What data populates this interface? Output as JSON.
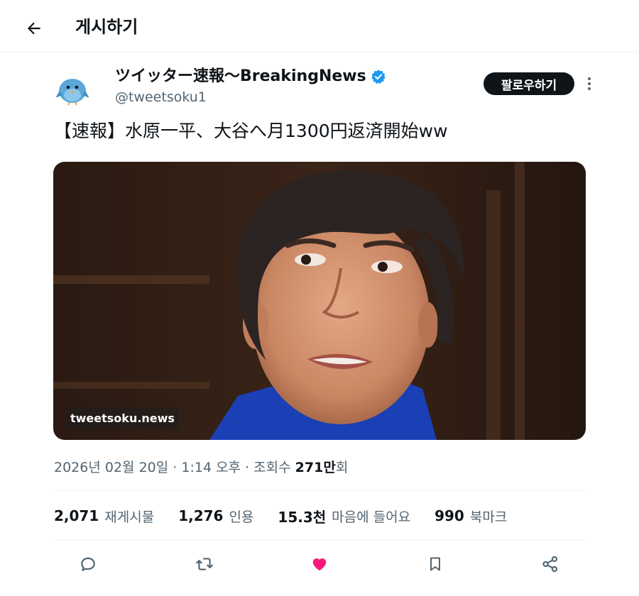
{
  "header": {
    "title": "게시하기",
    "back_icon": "arrow-left-icon"
  },
  "author": {
    "display_name": "ツイッター速報〜BreakingNews",
    "handle": "@tweetsoku1",
    "verified": true,
    "verified_color": "#1d9bf0",
    "avatar_icon": "bird-avatar-icon"
  },
  "follow_button": {
    "label": "팔로우하기"
  },
  "tweet": {
    "text": "【速報】水原一平、大谷へ月1300円返済開始ww",
    "media": {
      "watermark": "tweetsoku.news"
    }
  },
  "meta": {
    "date": "2026년 02월 20일",
    "time": "1:14 오후",
    "separator": " · ",
    "views_label": "조회수",
    "views_value": "271만",
    "views_suffix": "회"
  },
  "stats": [
    {
      "value": "2,071",
      "label": "재게시물"
    },
    {
      "value": "1,276",
      "label": "인용"
    },
    {
      "value": "15.3천",
      "label": "마음에 들어요"
    },
    {
      "value": "990",
      "label": "북마크"
    }
  ],
  "actions": [
    {
      "icon": "reply-icon"
    },
    {
      "icon": "repost-icon"
    },
    {
      "icon": "like-icon",
      "active": true,
      "color": "#f91880"
    },
    {
      "icon": "bookmark-icon"
    },
    {
      "icon": "share-icon"
    }
  ],
  "colors": {
    "text_primary": "#0f1419",
    "text_secondary": "#536471",
    "accent": "#1d9bf0",
    "like": "#f91880"
  }
}
